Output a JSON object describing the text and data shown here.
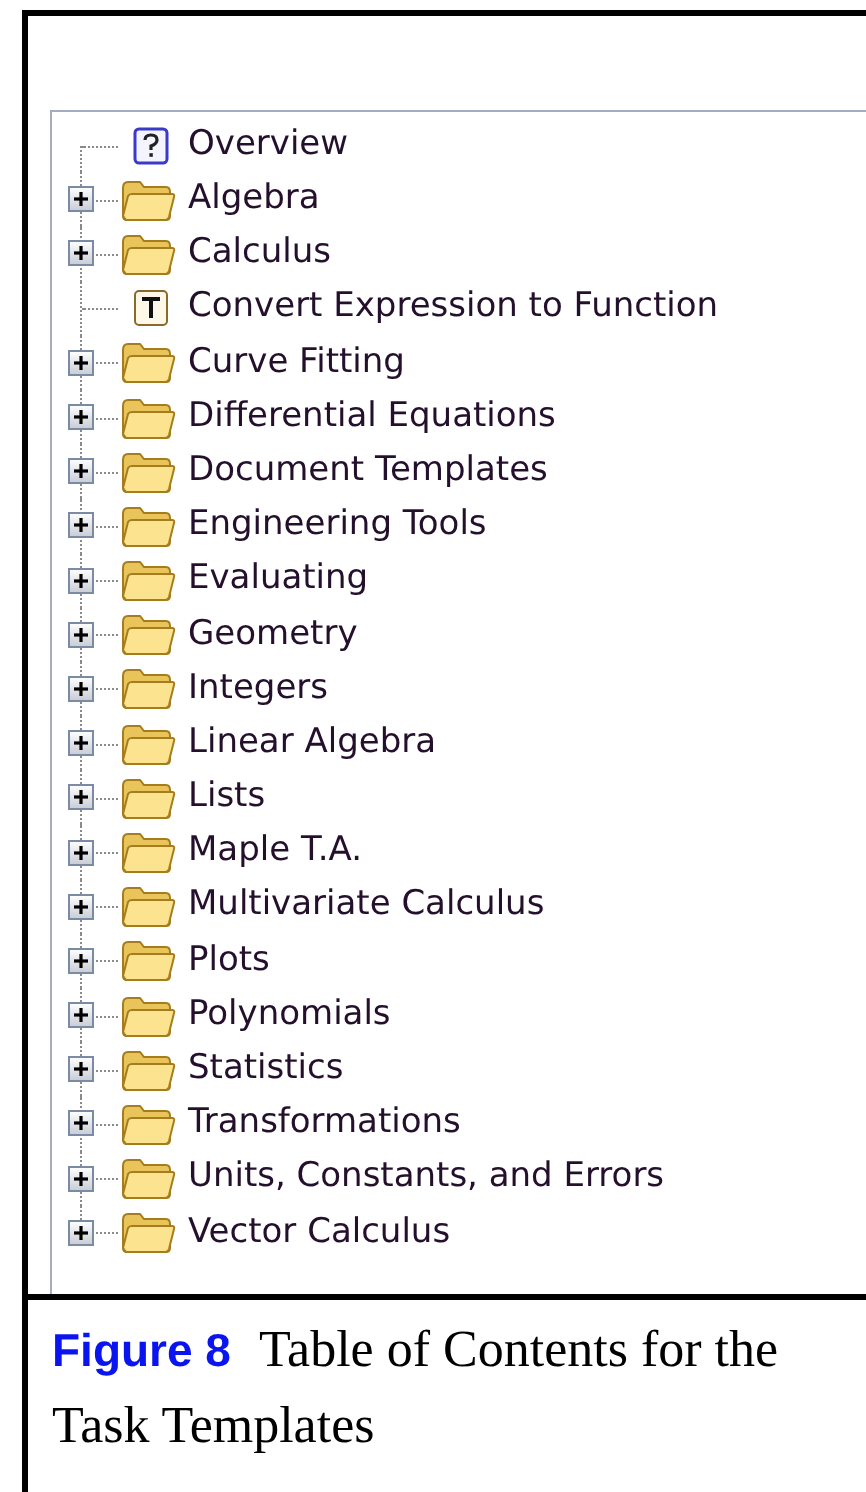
{
  "tree": {
    "items": [
      {
        "label": "Overview",
        "kind": "topic"
      },
      {
        "label": "Algebra",
        "kind": "folder",
        "expanded": false
      },
      {
        "label": "Calculus",
        "kind": "folder",
        "expanded": false
      },
      {
        "label": "Convert Expression to Function",
        "kind": "task"
      },
      {
        "label": "Curve Fitting",
        "kind": "folder",
        "expanded": false
      },
      {
        "label": "Differential Equations",
        "kind": "folder",
        "expanded": false
      },
      {
        "label": "Document Templates",
        "kind": "folder",
        "expanded": false
      },
      {
        "label": "Engineering Tools",
        "kind": "folder",
        "expanded": false
      },
      {
        "label": "Evaluating",
        "kind": "folder",
        "expanded": false
      },
      {
        "label": "Geometry",
        "kind": "folder",
        "expanded": false
      },
      {
        "label": "Integers",
        "kind": "folder",
        "expanded": false
      },
      {
        "label": "Linear Algebra",
        "kind": "folder",
        "expanded": false
      },
      {
        "label": "Lists",
        "kind": "folder",
        "expanded": false
      },
      {
        "label": "Maple T.A.",
        "kind": "folder",
        "expanded": false
      },
      {
        "label": "Multivariate Calculus",
        "kind": "folder",
        "expanded": false
      },
      {
        "label": "Plots",
        "kind": "folder",
        "expanded": false
      },
      {
        "label": "Polynomials",
        "kind": "folder",
        "expanded": false
      },
      {
        "label": "Statistics",
        "kind": "folder",
        "expanded": false
      },
      {
        "label": "Transformations",
        "kind": "folder",
        "expanded": false
      },
      {
        "label": "Units, Constants, and Errors",
        "kind": "folder",
        "expanded": false
      },
      {
        "label": "Vector Calculus",
        "kind": "folder",
        "expanded": false
      }
    ]
  },
  "caption": {
    "label": "Figure 8",
    "text": "Table of Contents for the Task Templates"
  }
}
